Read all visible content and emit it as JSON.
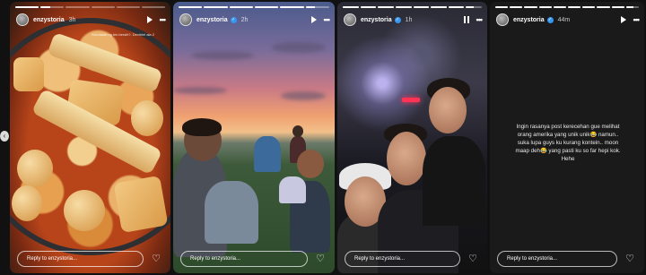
{
  "stories": [
    {
      "username": "enzystoria",
      "time": "3h",
      "caption": "Kendalah ng bin bersih?. Devitriel ala 2",
      "reply_placeholder": "Reply to enzystoria...",
      "progress": [
        1.0,
        0.4,
        0.0,
        0.0,
        0.0,
        0.0
      ],
      "control": "play"
    },
    {
      "username": "enzystoria",
      "time": "2h",
      "reply_placeholder": "Reply to enzystoria...",
      "progress": [
        1.0,
        1.0,
        1.0,
        1.0,
        1.0,
        0.4
      ],
      "control": "play"
    },
    {
      "username": "enzystoria",
      "time": "1h",
      "reply_placeholder": "Reply to enzystoria...",
      "progress": [
        1.0,
        1.0,
        1.0,
        1.0,
        1.0,
        1.0,
        1.0,
        0.5
      ],
      "control": "pause"
    },
    {
      "username": "enzystoria",
      "time": "44m",
      "text": "Ingin rasanya post kerecehan gue melihat orang amerika yang unik unik😂 namun.. suka lupa guys ku kurang kontein.. moon maap deh😂 yang pasti ku so far hepi kok. Hehe",
      "reply_placeholder": "Reply to enzystoria...",
      "progress": [
        1.0,
        1.0,
        1.0,
        1.0,
        1.0,
        1.0,
        1.0,
        1.0,
        1.0,
        0.6
      ],
      "control": "play"
    }
  ],
  "icons": {
    "more": "•••",
    "heart": "♡",
    "nav_left": "‹",
    "verified": "✓"
  },
  "colors": {
    "background": "#111111",
    "verified": "#3897f0",
    "neon_sign": "#ff3355"
  }
}
